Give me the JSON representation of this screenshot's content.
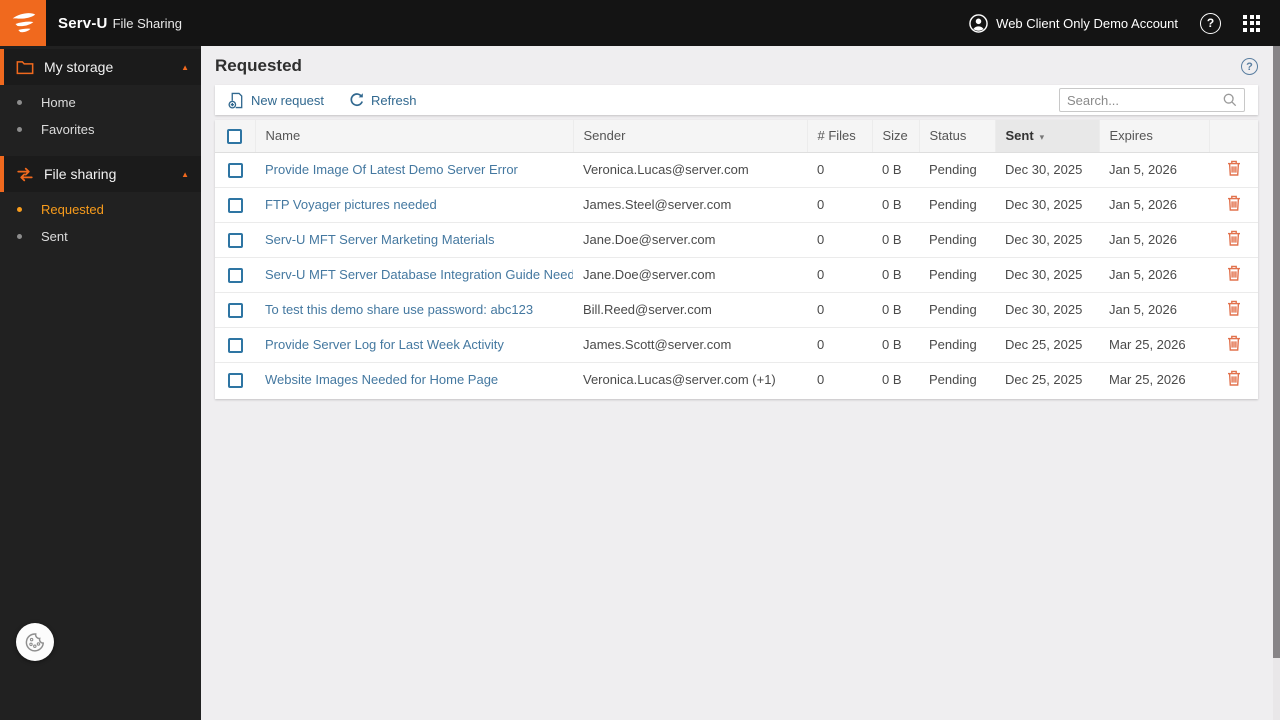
{
  "colors": {
    "accent-orange": "#f0691e",
    "sidebar-active-orange": "#f89c1c",
    "link-blue": "#4478a0",
    "toolbar-blue": "#31688f",
    "trash-orange": "#e2724d",
    "topbar-bg": "#141414",
    "sidebar-bg": "#212121",
    "content-bg": "#efeef0"
  },
  "icons": {
    "collapse_caret": "▲",
    "sort_desc": "▾",
    "help": "?"
  },
  "topbar": {
    "brand_primary": "Serv-U",
    "brand_secondary": "File Sharing",
    "account_label": "Web Client Only Demo Account"
  },
  "sidebar": {
    "groups": [
      {
        "label": "My storage",
        "items": [
          {
            "label": "Home"
          },
          {
            "label": "Favorites"
          }
        ]
      },
      {
        "label": "File sharing",
        "items": [
          {
            "label": "Requested"
          },
          {
            "label": "Sent"
          }
        ]
      }
    ]
  },
  "main": {
    "title": "Requested",
    "toolbar": {
      "new_request": "New request",
      "refresh": "Refresh"
    },
    "search_placeholder": "Search...",
    "table": {
      "headers": {
        "name": "Name",
        "sender": "Sender",
        "files": "# Files",
        "size": "Size",
        "status": "Status",
        "sent": "Sent",
        "expires": "Expires"
      },
      "sort": {
        "column": "Sent",
        "direction": "desc"
      },
      "rows": [
        {
          "name": "Provide Image Of Latest Demo Server Error",
          "sender": "Veronica.Lucas@server.com",
          "files": "0",
          "size": "0 B",
          "status": "Pending",
          "sent": "Dec 30, 2025",
          "expires": "Jan 5, 2026"
        },
        {
          "name": "FTP Voyager pictures needed",
          "sender": "James.Steel@server.com",
          "files": "0",
          "size": "0 B",
          "status": "Pending",
          "sent": "Dec 30, 2025",
          "expires": "Jan 5, 2026"
        },
        {
          "name": "Serv-U MFT Server Marketing Materials",
          "sender": "Jane.Doe@server.com",
          "files": "0",
          "size": "0 B",
          "status": "Pending",
          "sent": "Dec 30, 2025",
          "expires": "Jan 5, 2026"
        },
        {
          "name": "Serv-U MFT Server Database Integration Guide Needed",
          "sender": "Jane.Doe@server.com",
          "files": "0",
          "size": "0 B",
          "status": "Pending",
          "sent": "Dec 30, 2025",
          "expires": "Jan 5, 2026"
        },
        {
          "name": "To test this demo share use password: abc123",
          "sender": "Bill.Reed@server.com",
          "files": "0",
          "size": "0 B",
          "status": "Pending",
          "sent": "Dec 30, 2025",
          "expires": "Jan 5, 2026"
        },
        {
          "name": "Provide Server Log for Last Week Activity",
          "sender": "James.Scott@server.com",
          "files": "0",
          "size": "0 B",
          "status": "Pending",
          "sent": "Dec 25, 2025",
          "expires": "Mar 25, 2026"
        },
        {
          "name": "Website Images Needed for Home Page",
          "sender": "Veronica.Lucas@server.com (+1)",
          "files": "0",
          "size": "0 B",
          "status": "Pending",
          "sent": "Dec 25, 2025",
          "expires": "Mar 25, 2026"
        }
      ]
    }
  }
}
